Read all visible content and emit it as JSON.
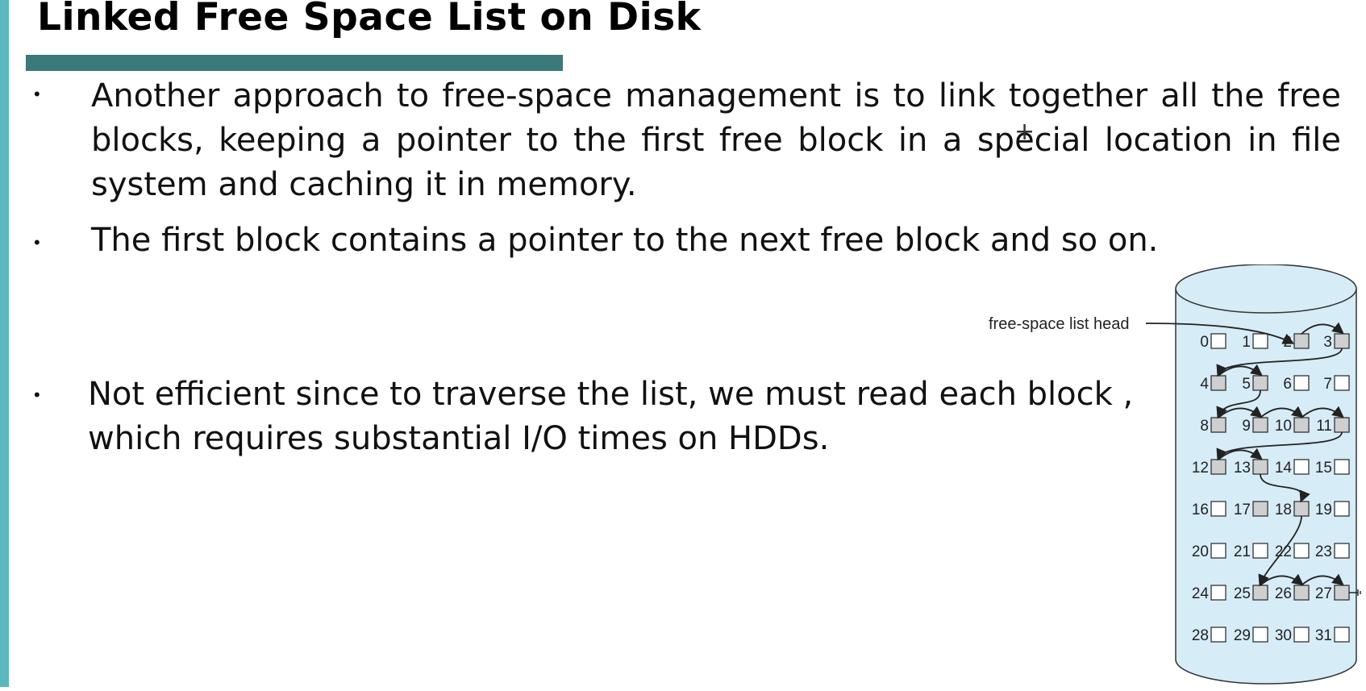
{
  "slide": {
    "title": "Linked Free Space List on Disk",
    "bullets": [
      {
        "lines": [
          "Another approach to free-space management is to link together all the free",
          "blocks, keeping a pointer to the first free block in a special location in file",
          "system and caching it in memory."
        ]
      },
      {
        "lines": [
          "The first block contains a pointer to the next free block and so on."
        ]
      },
      {
        "lines": [
          "Not efficient since to traverse the list, we must read each block ,",
          "which requires substantial I/O times on HDDs."
        ]
      }
    ]
  },
  "diagram": {
    "head_label": "free-space list head",
    "block_numbers": [
      "0",
      "1",
      "2",
      "3",
      "4",
      "5",
      "6",
      "7",
      "8",
      "9",
      "10",
      "11",
      "12",
      "13",
      "14",
      "15",
      "16",
      "17",
      "18",
      "19",
      "20",
      "21",
      "22",
      "23",
      "24",
      "25",
      "26",
      "27",
      "28",
      "29",
      "30",
      "31"
    ],
    "free_blocks": [
      2,
      3,
      4,
      5,
      8,
      9,
      10,
      11,
      12,
      13,
      17,
      18,
      25,
      26,
      27
    ],
    "free_list_order": [
      2,
      3,
      4,
      5,
      8,
      9,
      10,
      11,
      12,
      13,
      18,
      25,
      26,
      27
    ],
    "free_color": "#cfcfcf",
    "used_color": "#ffffff",
    "cylinder_color": "#d6ecf7"
  },
  "colors": {
    "accent_bar": "#5bb9be",
    "title_rule": "#3a7a7a"
  }
}
